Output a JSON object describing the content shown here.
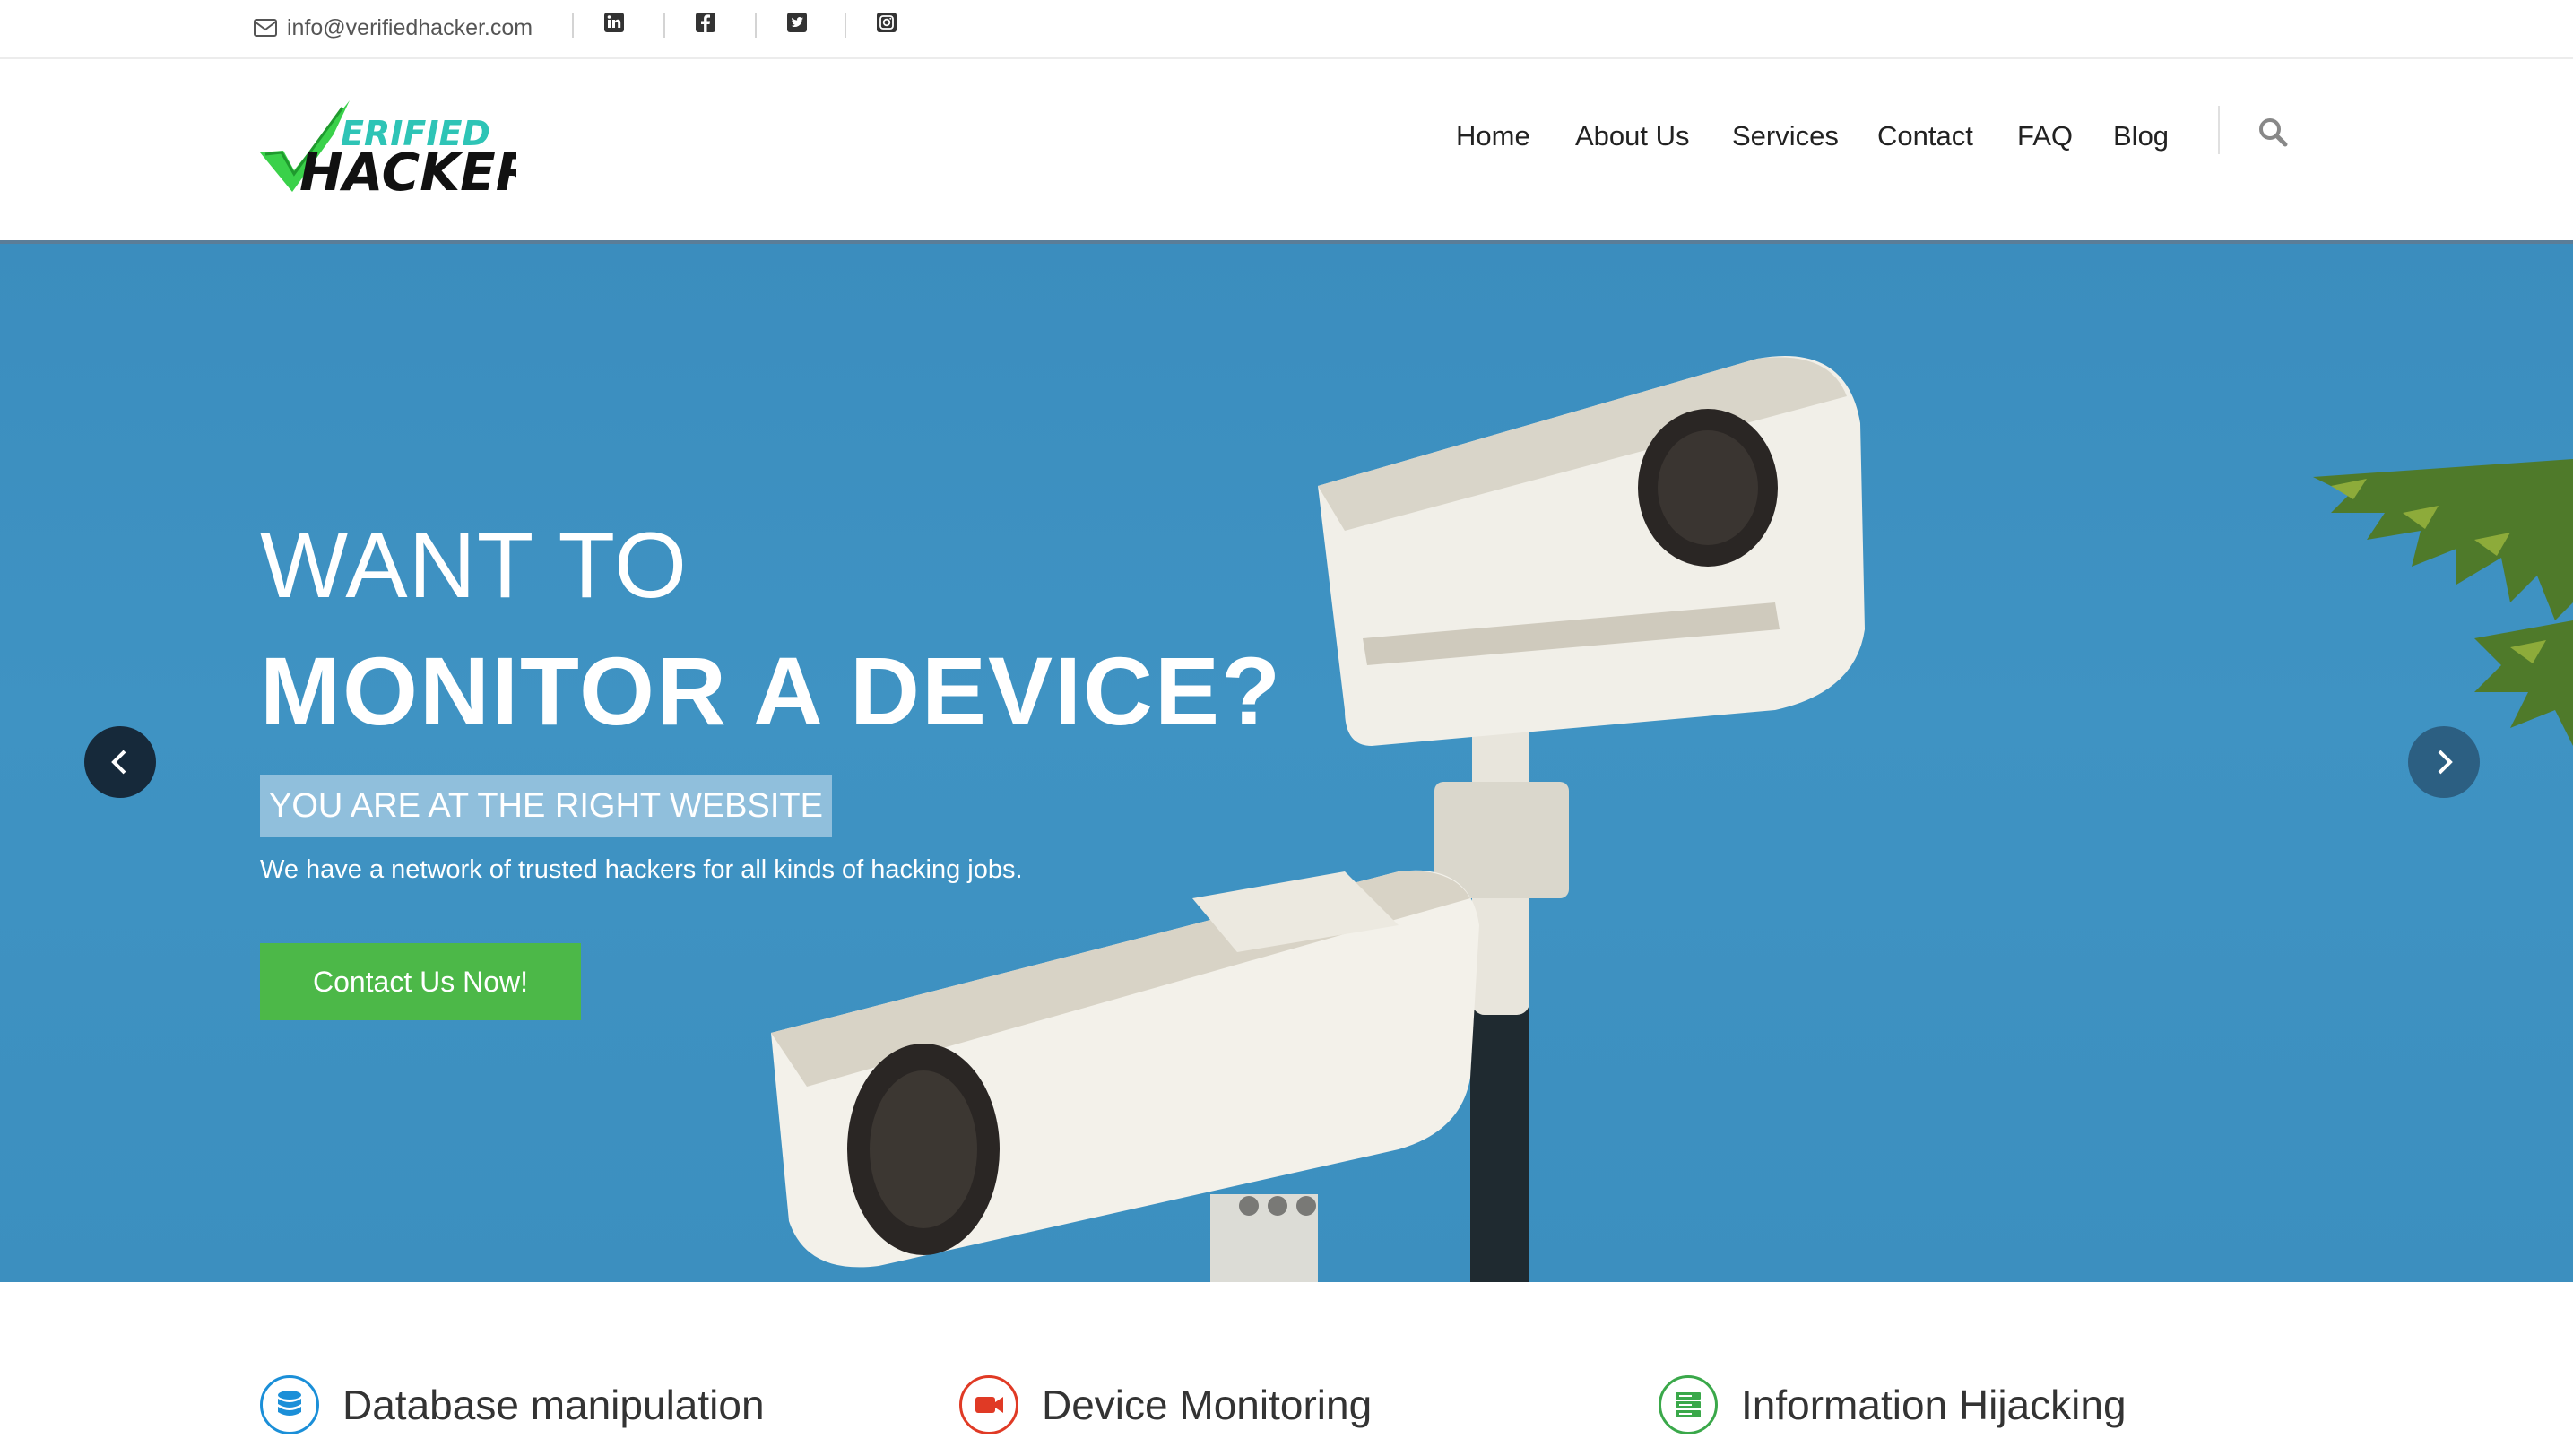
{
  "topbar": {
    "email": "info@verifiedhacker.com",
    "social_icons": [
      "linkedin-icon",
      "facebook-icon",
      "twitter-icon",
      "instagram-icon"
    ]
  },
  "logo": {
    "line1": "ERIFIED",
    "line2": "HACKER"
  },
  "nav": {
    "items": [
      "Home",
      "About Us",
      "Services",
      "Contact",
      "FAQ",
      "Blog"
    ]
  },
  "hero": {
    "line1": "WANT TO",
    "line2": "MONITOR A DEVICE?",
    "tagline": "YOU ARE AT THE RIGHT WEBSITE",
    "description": "We have a network of trusted hackers for all kinds of hacking jobs.",
    "cta_label": "Contact Us Now!",
    "slide_count": 3
  },
  "features": [
    {
      "title": "Database manipulation",
      "icon": "database-icon",
      "color": "#1b8fd8"
    },
    {
      "title": "Device Monitoring",
      "icon": "video-camera-icon",
      "color": "#e03a25"
    },
    {
      "title": "Information Hijacking",
      "icon": "server-icon",
      "color": "#3aa84a"
    }
  ],
  "colors": {
    "accent_green": "#4cb848",
    "hero_blue": "#3c8fbf",
    "logo_teal": "#2ec4b6",
    "logo_check": "#3ad14a"
  }
}
